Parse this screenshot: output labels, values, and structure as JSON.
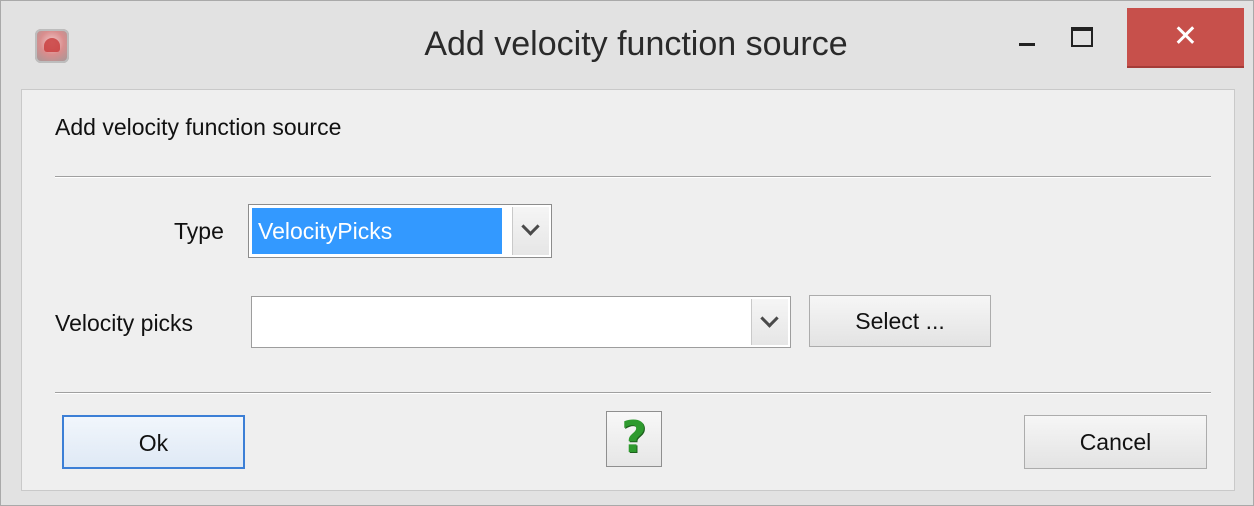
{
  "window": {
    "title": "Add velocity function source",
    "close_glyph": "✕",
    "icon": "app-icon"
  },
  "dialog": {
    "header": "Add velocity function source"
  },
  "form": {
    "type_label": "Type",
    "type_value": "VelocityPicks",
    "picks_label": "Velocity picks",
    "picks_value": "",
    "select_button": "Select ..."
  },
  "buttons": {
    "ok": "Ok",
    "help_glyph": "?",
    "cancel": "Cancel"
  },
  "colors": {
    "selection": "#3399ff",
    "close_button": "#c7504b",
    "help_icon": "#2e9a2e"
  }
}
